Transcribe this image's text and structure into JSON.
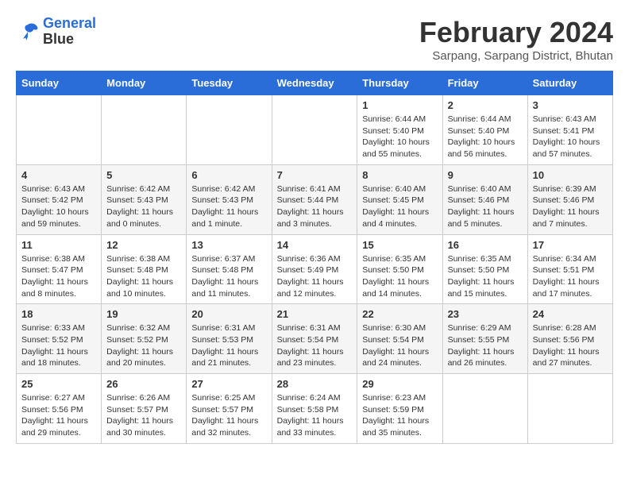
{
  "logo": {
    "line1": "General",
    "line2": "Blue"
  },
  "title": "February 2024",
  "subtitle": "Sarpang, Sarpang District, Bhutan",
  "headers": [
    "Sunday",
    "Monday",
    "Tuesday",
    "Wednesday",
    "Thursday",
    "Friday",
    "Saturday"
  ],
  "weeks": [
    [
      {
        "day": "",
        "info": ""
      },
      {
        "day": "",
        "info": ""
      },
      {
        "day": "",
        "info": ""
      },
      {
        "day": "",
        "info": ""
      },
      {
        "day": "1",
        "info": "Sunrise: 6:44 AM\nSunset: 5:40 PM\nDaylight: 10 hours\nand 55 minutes."
      },
      {
        "day": "2",
        "info": "Sunrise: 6:44 AM\nSunset: 5:40 PM\nDaylight: 10 hours\nand 56 minutes."
      },
      {
        "day": "3",
        "info": "Sunrise: 6:43 AM\nSunset: 5:41 PM\nDaylight: 10 hours\nand 57 minutes."
      }
    ],
    [
      {
        "day": "4",
        "info": "Sunrise: 6:43 AM\nSunset: 5:42 PM\nDaylight: 10 hours\nand 59 minutes."
      },
      {
        "day": "5",
        "info": "Sunrise: 6:42 AM\nSunset: 5:43 PM\nDaylight: 11 hours\nand 0 minutes."
      },
      {
        "day": "6",
        "info": "Sunrise: 6:42 AM\nSunset: 5:43 PM\nDaylight: 11 hours\nand 1 minute."
      },
      {
        "day": "7",
        "info": "Sunrise: 6:41 AM\nSunset: 5:44 PM\nDaylight: 11 hours\nand 3 minutes."
      },
      {
        "day": "8",
        "info": "Sunrise: 6:40 AM\nSunset: 5:45 PM\nDaylight: 11 hours\nand 4 minutes."
      },
      {
        "day": "9",
        "info": "Sunrise: 6:40 AM\nSunset: 5:46 PM\nDaylight: 11 hours\nand 5 minutes."
      },
      {
        "day": "10",
        "info": "Sunrise: 6:39 AM\nSunset: 5:46 PM\nDaylight: 11 hours\nand 7 minutes."
      }
    ],
    [
      {
        "day": "11",
        "info": "Sunrise: 6:38 AM\nSunset: 5:47 PM\nDaylight: 11 hours\nand 8 minutes."
      },
      {
        "day": "12",
        "info": "Sunrise: 6:38 AM\nSunset: 5:48 PM\nDaylight: 11 hours\nand 10 minutes."
      },
      {
        "day": "13",
        "info": "Sunrise: 6:37 AM\nSunset: 5:48 PM\nDaylight: 11 hours\nand 11 minutes."
      },
      {
        "day": "14",
        "info": "Sunrise: 6:36 AM\nSunset: 5:49 PM\nDaylight: 11 hours\nand 12 minutes."
      },
      {
        "day": "15",
        "info": "Sunrise: 6:35 AM\nSunset: 5:50 PM\nDaylight: 11 hours\nand 14 minutes."
      },
      {
        "day": "16",
        "info": "Sunrise: 6:35 AM\nSunset: 5:50 PM\nDaylight: 11 hours\nand 15 minutes."
      },
      {
        "day": "17",
        "info": "Sunrise: 6:34 AM\nSunset: 5:51 PM\nDaylight: 11 hours\nand 17 minutes."
      }
    ],
    [
      {
        "day": "18",
        "info": "Sunrise: 6:33 AM\nSunset: 5:52 PM\nDaylight: 11 hours\nand 18 minutes."
      },
      {
        "day": "19",
        "info": "Sunrise: 6:32 AM\nSunset: 5:52 PM\nDaylight: 11 hours\nand 20 minutes."
      },
      {
        "day": "20",
        "info": "Sunrise: 6:31 AM\nSunset: 5:53 PM\nDaylight: 11 hours\nand 21 minutes."
      },
      {
        "day": "21",
        "info": "Sunrise: 6:31 AM\nSunset: 5:54 PM\nDaylight: 11 hours\nand 23 minutes."
      },
      {
        "day": "22",
        "info": "Sunrise: 6:30 AM\nSunset: 5:54 PM\nDaylight: 11 hours\nand 24 minutes."
      },
      {
        "day": "23",
        "info": "Sunrise: 6:29 AM\nSunset: 5:55 PM\nDaylight: 11 hours\nand 26 minutes."
      },
      {
        "day": "24",
        "info": "Sunrise: 6:28 AM\nSunset: 5:56 PM\nDaylight: 11 hours\nand 27 minutes."
      }
    ],
    [
      {
        "day": "25",
        "info": "Sunrise: 6:27 AM\nSunset: 5:56 PM\nDaylight: 11 hours\nand 29 minutes."
      },
      {
        "day": "26",
        "info": "Sunrise: 6:26 AM\nSunset: 5:57 PM\nDaylight: 11 hours\nand 30 minutes."
      },
      {
        "day": "27",
        "info": "Sunrise: 6:25 AM\nSunset: 5:57 PM\nDaylight: 11 hours\nand 32 minutes."
      },
      {
        "day": "28",
        "info": "Sunrise: 6:24 AM\nSunset: 5:58 PM\nDaylight: 11 hours\nand 33 minutes."
      },
      {
        "day": "29",
        "info": "Sunrise: 6:23 AM\nSunset: 5:59 PM\nDaylight: 11 hours\nand 35 minutes."
      },
      {
        "day": "",
        "info": ""
      },
      {
        "day": "",
        "info": ""
      }
    ]
  ]
}
